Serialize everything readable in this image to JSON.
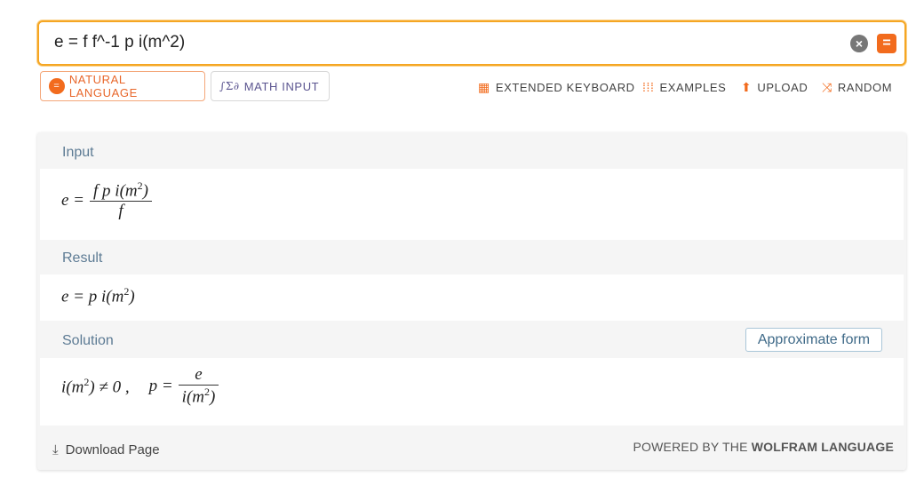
{
  "search": {
    "query": "e = f f^-1 p i(m^2)",
    "clear_icon": "×",
    "submit_icon": "="
  },
  "modes": {
    "natural_language": "NATURAL LANGUAGE",
    "math_input": "MATH INPUT"
  },
  "toolbar": {
    "extended_keyboard": "EXTENDED KEYBOARD",
    "examples": "EXAMPLES",
    "upload": "UPLOAD",
    "random": "RANDOM"
  },
  "pods": {
    "input": {
      "title": "Input",
      "lhs": "e =",
      "numerator": "f p i(m",
      "numerator_sup": "2",
      "numerator_end": ")",
      "denominator": "f"
    },
    "result": {
      "title": "Result",
      "expr": "e = p i(m",
      "expr_sup": "2",
      "expr_end": ")"
    },
    "solution": {
      "title": "Solution",
      "condition": "i(m",
      "condition_sup": "2",
      "condition_end": ") ≠ 0 ,",
      "lhs": "p =",
      "numerator": "e",
      "denominator": "i(m",
      "denominator_sup": "2",
      "denominator_end": ")",
      "approx_button": "Approximate form"
    }
  },
  "footer": {
    "download": "Download Page",
    "powered_prefix": "POWERED BY THE ",
    "powered_brand": "WOLFRAM LANGUAGE"
  },
  "colors": {
    "accent": "#f26b1d",
    "search_border": "#f5a623",
    "pod_title": "#5d7b94"
  }
}
